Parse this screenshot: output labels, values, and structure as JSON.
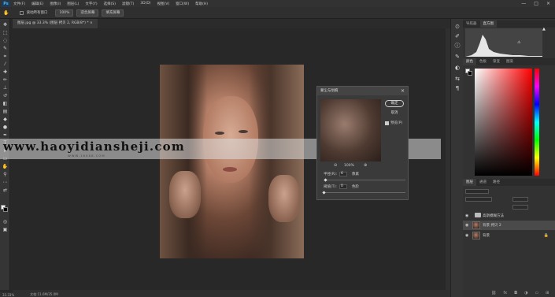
{
  "menubar": {
    "logo": "Ps",
    "items": [
      "文件(F)",
      "编辑(E)",
      "图像(I)",
      "图层(L)",
      "文字(Y)",
      "选择(S)",
      "滤镜(T)",
      "3D(D)",
      "视图(V)",
      "窗口(W)",
      "帮助(H)"
    ],
    "win": {
      "minimize": "—",
      "maximize": "□",
      "close": "×"
    }
  },
  "options": {
    "scroll_all": "滚动所有窗口",
    "zoom": "100%",
    "fit_screen": "适合屏幕",
    "fill_screen": "填充屏幕"
  },
  "document": {
    "tab_label": "图层.jpg @ 33.3% (图层 拷贝 2, RGB/8*) * ×"
  },
  "watermark": {
    "text": "www.haoyidiansheji.com",
    "sub": "WWW.16XX8.COM"
  },
  "dialog": {
    "title": "蒙尘与划痕",
    "close": "×",
    "ok": "确定",
    "cancel": "取消",
    "preview_label": "预览(P)",
    "zoom_out": "⊖",
    "zoom_in": "⊕",
    "zoom_value": "100%",
    "radius_label": "半径(R):",
    "radius_value": "6",
    "radius_unit": "像素",
    "threshold_label": "阈值(T):",
    "threshold_value": "0",
    "threshold_unit": "色阶"
  },
  "status": {
    "zoom": "33.33%",
    "doc": "文档:11.6M/35.0M"
  },
  "panels": {
    "hist_tabs": [
      "导航器",
      "直方图"
    ],
    "color_tabs": [
      "颜色",
      "色板",
      "渐变",
      "图案"
    ],
    "layers_tabs": [
      "图层",
      "通道",
      "路径"
    ],
    "hist_warn": "⚠",
    "hist_tri": "▲"
  },
  "layers": [
    {
      "name": "高斯模糊方法",
      "type": "group"
    },
    {
      "name": "背景 拷贝 2",
      "type": "layer",
      "selected": true
    },
    {
      "name": "背景",
      "type": "layer",
      "locked": true
    }
  ],
  "colors": {
    "accent": "#4fb0f0",
    "bg": "#282828"
  }
}
